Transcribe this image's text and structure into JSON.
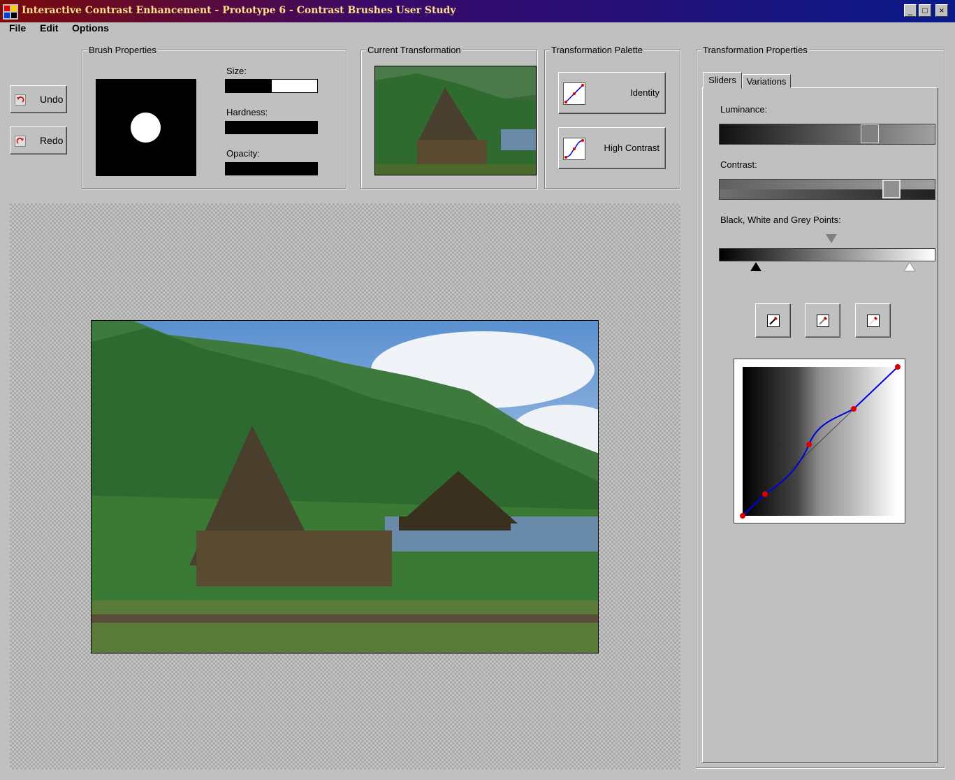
{
  "window": {
    "title": "Interactive Contrast Enhancement - Prototype 6 - Contrast Brushes User Study",
    "controls": [
      "_",
      "□",
      "×"
    ]
  },
  "menu": [
    "File",
    "Edit",
    "Options"
  ],
  "toolbar": {
    "undo_label": "Undo",
    "redo_label": "Redo"
  },
  "brush_properties": {
    "title": "Brush Properties",
    "size_label": "Size:",
    "size_value": 0.5,
    "hardness_label": "Hardness:",
    "hardness_value": 1.0,
    "opacity_label": "Opacity:",
    "opacity_value": 1.0
  },
  "current_transformation": {
    "title": "Current Transformation"
  },
  "palette": {
    "title": "Transformation Palette",
    "items": [
      {
        "label": "Identity",
        "icon": "identity-curve-icon"
      },
      {
        "label": "High Contrast",
        "icon": "s-curve-icon"
      }
    ]
  },
  "properties": {
    "title": "Transformation Properties",
    "tabs": [
      "Sliders",
      "Variations"
    ],
    "active_tab": "Sliders",
    "luminance_label": "Luminance:",
    "luminance_value": 0.71,
    "contrast_label": "Contrast:",
    "contrast_value": 0.82,
    "points_label": "Black, White and Grey Points:",
    "black_point": 0.17,
    "grey_point": 0.52,
    "white_point": 0.88,
    "eyedroppers": [
      "black-eyedropper-icon",
      "grey-eyedropper-icon",
      "white-eyedropper-icon"
    ]
  },
  "colors": {
    "curve": "#0000e0",
    "control_point": "#e00000",
    "title_text": "#ffe08a"
  }
}
